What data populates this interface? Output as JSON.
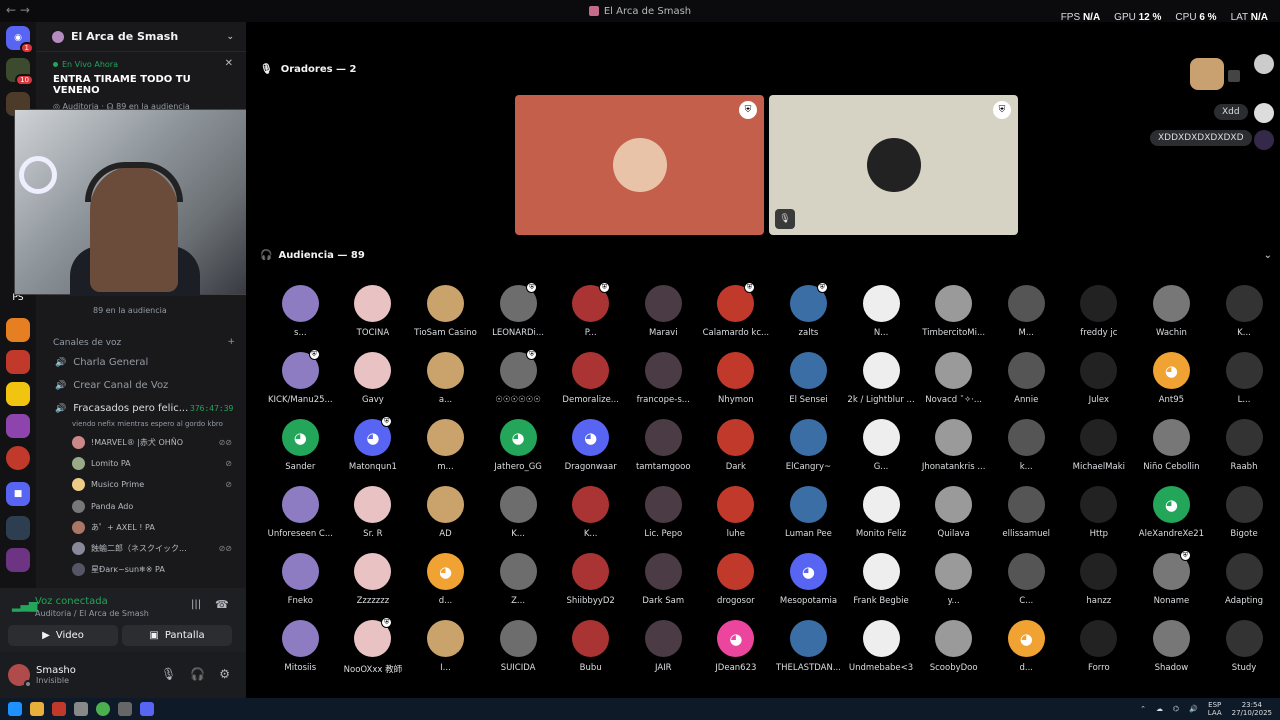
{
  "window": {
    "title": "El Arca de Smash"
  },
  "perf": [
    {
      "label": "FPS",
      "value": "N/A"
    },
    {
      "label": "GPU",
      "value": "12 %"
    },
    {
      "label": "CPU",
      "value": "6 %"
    },
    {
      "label": "LAT",
      "value": "N/A"
    }
  ],
  "serverbar": {
    "badges": [
      "1",
      "10"
    ],
    "labels": [
      "PS"
    ]
  },
  "guild": {
    "name": "El Arca de Smash"
  },
  "live": {
    "tag": "En Vivo Ahora",
    "stage": "ENTRA TIRAME TODO TU VENENO",
    "channel": "Auditoria",
    "audience": "89 en la audiencia"
  },
  "audience_side": "89 en la audiencia",
  "voice_category": "Canales de voz",
  "channels": [
    {
      "name": "Charla General"
    },
    {
      "name": "Crear Canal de Voz"
    },
    {
      "name": "Fracasados pero felic..."
    }
  ],
  "active_channel": {
    "timer": "376:47:39",
    "subtitle": "viendo nefix mientras espero al gordo kbro"
  },
  "voice_users": [
    {
      "name": "!MARVEL® |赤犬",
      "tag": "OHÑO"
    },
    {
      "name": "Lomito",
      "tag": "PA"
    },
    {
      "name": "Musico Prime",
      "tag": ""
    },
    {
      "name": "Panda",
      "tag": "Ado"
    },
    {
      "name": "あ゜+ AXEL !",
      "tag": "PA"
    },
    {
      "name": "蝕蝓二郎（ネスクイック...",
      "tag": ""
    },
    {
      "name": "星Đarĸ~sun❄※",
      "tag": "PA"
    }
  ],
  "voice_connected": {
    "label": "Voz conectada",
    "sub": "Auditoria / El Arca de Smash",
    "video": "Video",
    "screen": "Pantalla"
  },
  "user": {
    "name": "Smasho",
    "status": "Invisible"
  },
  "speakers": {
    "header": "Oradores — 2"
  },
  "audience": {
    "header": "Audiencia — 89"
  },
  "members": [
    "s...",
    "TOCINA",
    "TioSam Casino",
    "LEONARDi...",
    "P...",
    "Maravi",
    "Calamardo kc...",
    "zalts",
    "N...",
    "TimbercitoMi...",
    "M...",
    "freddy jc",
    "Wachin",
    "K...",
    "KICK/Manu25...",
    "Gavy",
    "a...",
    "☉☉☉☉☉☉",
    "Demoralize...",
    "francope-s...",
    "Nhymon",
    "El Sensei",
    "2k / Lightblur ...",
    "Novacd ˚✧·...",
    "Annie",
    "Julex",
    "Ant95",
    "L...",
    "Sander",
    "Matonqun1",
    "m...",
    "Jathero_GG",
    "Dragonwaar",
    "tamtamgooo",
    "Dark",
    "ElCangry~",
    "G...",
    "Jhonatankris ...",
    "k...",
    "MichaelMaki",
    "Niño Cebollin",
    "Raabh",
    "Unforeseen C...",
    "Sr. R",
    "AD",
    "K...",
    "K...",
    "Lic. Pepo",
    "luhe",
    "Luman Pee",
    "Monito Feliz",
    "Quilava",
    "ellissamuel",
    "Http",
    "AleXandreXe21",
    "Bigote",
    "Fneko",
    "Zzzzzzz",
    "d...",
    "Z...",
    "ShiibbyyD2",
    "Dark Sam",
    "drogosor",
    "Mesopotamia",
    "Frank Begbie",
    "y...",
    "C...",
    "hanzz",
    "Noname",
    "Adapting",
    "Mitosiis",
    "NooOXxx 教師",
    "I...",
    "SUICIDA",
    "Bubu",
    "JAIR",
    "JDean623",
    "THELASTDAN...",
    "Undmebabe<3",
    "ScoobyDoo",
    "d...",
    "Forro",
    "Shadow",
    "Study"
  ],
  "chat": [
    {
      "text": "Xdd"
    },
    {
      "text": "XDDXDXDXDXDXD"
    }
  ],
  "taskbar": {
    "lang1": "ESP",
    "lang2": "LAA",
    "time": "23:54",
    "date": "27/10/2025"
  },
  "colors": {
    "accent": "#5865f2",
    "online": "#23a55a",
    "tile1": "#c45f4c",
    "tile2": "#d6d2c4"
  }
}
